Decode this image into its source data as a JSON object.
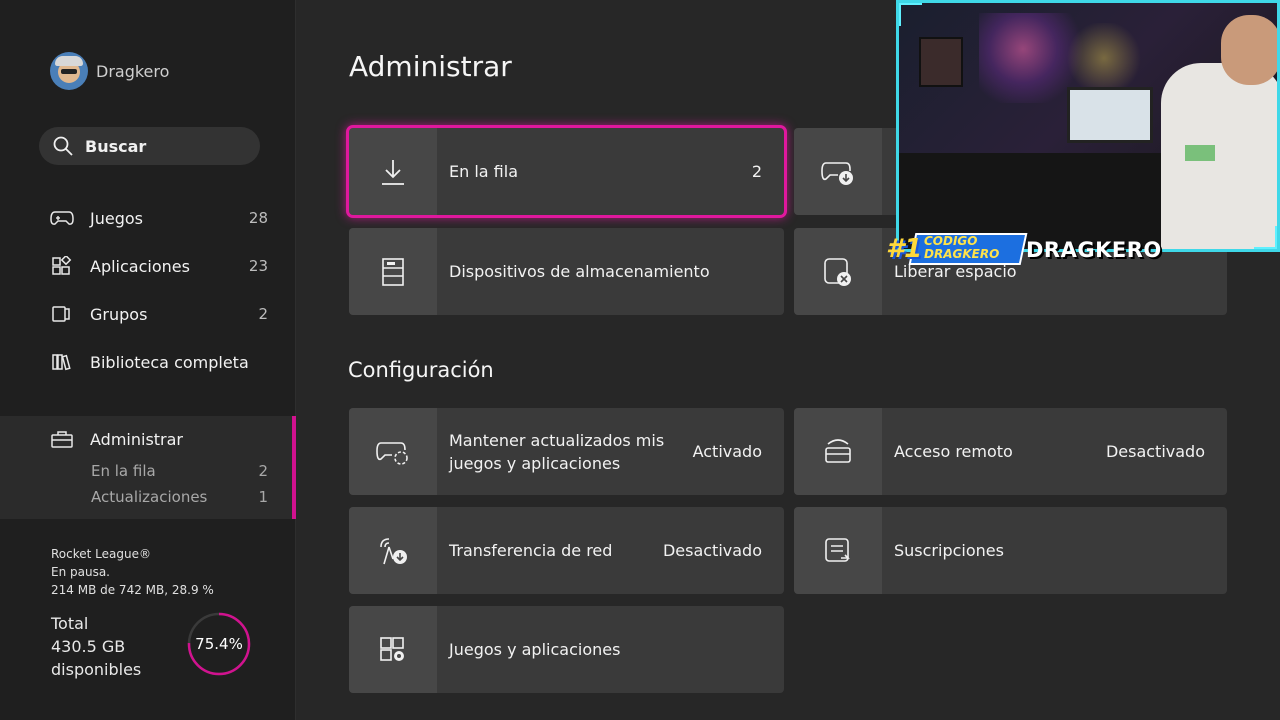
{
  "profile": {
    "name": "Dragkero"
  },
  "search": {
    "label": "Buscar"
  },
  "nav": [
    {
      "label": "Juegos",
      "count": "28",
      "icon": "controller-icon"
    },
    {
      "label": "Aplicaciones",
      "count": "23",
      "icon": "apps-icon"
    },
    {
      "label": "Grupos",
      "count": "2",
      "icon": "groups-icon"
    },
    {
      "label": "Biblioteca completa",
      "count": "",
      "icon": "library-icon"
    }
  ],
  "admin": {
    "label": "Administrar",
    "sub": [
      {
        "label": "En la fila",
        "count": "2"
      },
      {
        "label": "Actualizaciones",
        "count": "1"
      }
    ]
  },
  "download": {
    "title": "Rocket League®",
    "status": "En pausa.",
    "progress_text": "214 MB de 742 MB, 28.9 %"
  },
  "storage": {
    "total_label": "Total",
    "free": "430.5 GB",
    "free_label": "disponibles",
    "used_percent": 75.4,
    "used_label": "75.4%"
  },
  "main": {
    "title": "Administrar",
    "manage_tiles": [
      {
        "label": "En la fila",
        "value": "2",
        "icon": "download-icon"
      },
      {
        "label": "",
        "value": "",
        "icon": "controller-download-icon"
      },
      {
        "label": "Dispositivos de almacenamiento",
        "value": "",
        "icon": "storage-device-icon"
      },
      {
        "label": "Liberar espacio",
        "value": "",
        "icon": "free-space-icon"
      }
    ],
    "config_title": "Configuración",
    "config_tiles": [
      {
        "label": "Mantener actualizados mis juegos y aplicaciones",
        "value": "Activado",
        "icon": "controller-update-icon"
      },
      {
        "label": "Acceso remoto",
        "value": "Desactivado",
        "icon": "remote-access-icon"
      },
      {
        "label": "Transferencia de red",
        "value": "Desactivado",
        "icon": "network-transfer-icon"
      },
      {
        "label": "Suscripciones",
        "value": "",
        "icon": "subscriptions-icon"
      },
      {
        "label": "Juegos y aplicaciones",
        "value": "",
        "icon": "games-apps-settings-icon"
      }
    ]
  },
  "overlay": {
    "rank": "#1",
    "code_line1": "CODIGO",
    "code_line2": "DRAGKERO",
    "streamer": "DRAGKERO"
  },
  "colors": {
    "accent": "#d1128f",
    "webcam_frame": "#3fd8e8"
  }
}
